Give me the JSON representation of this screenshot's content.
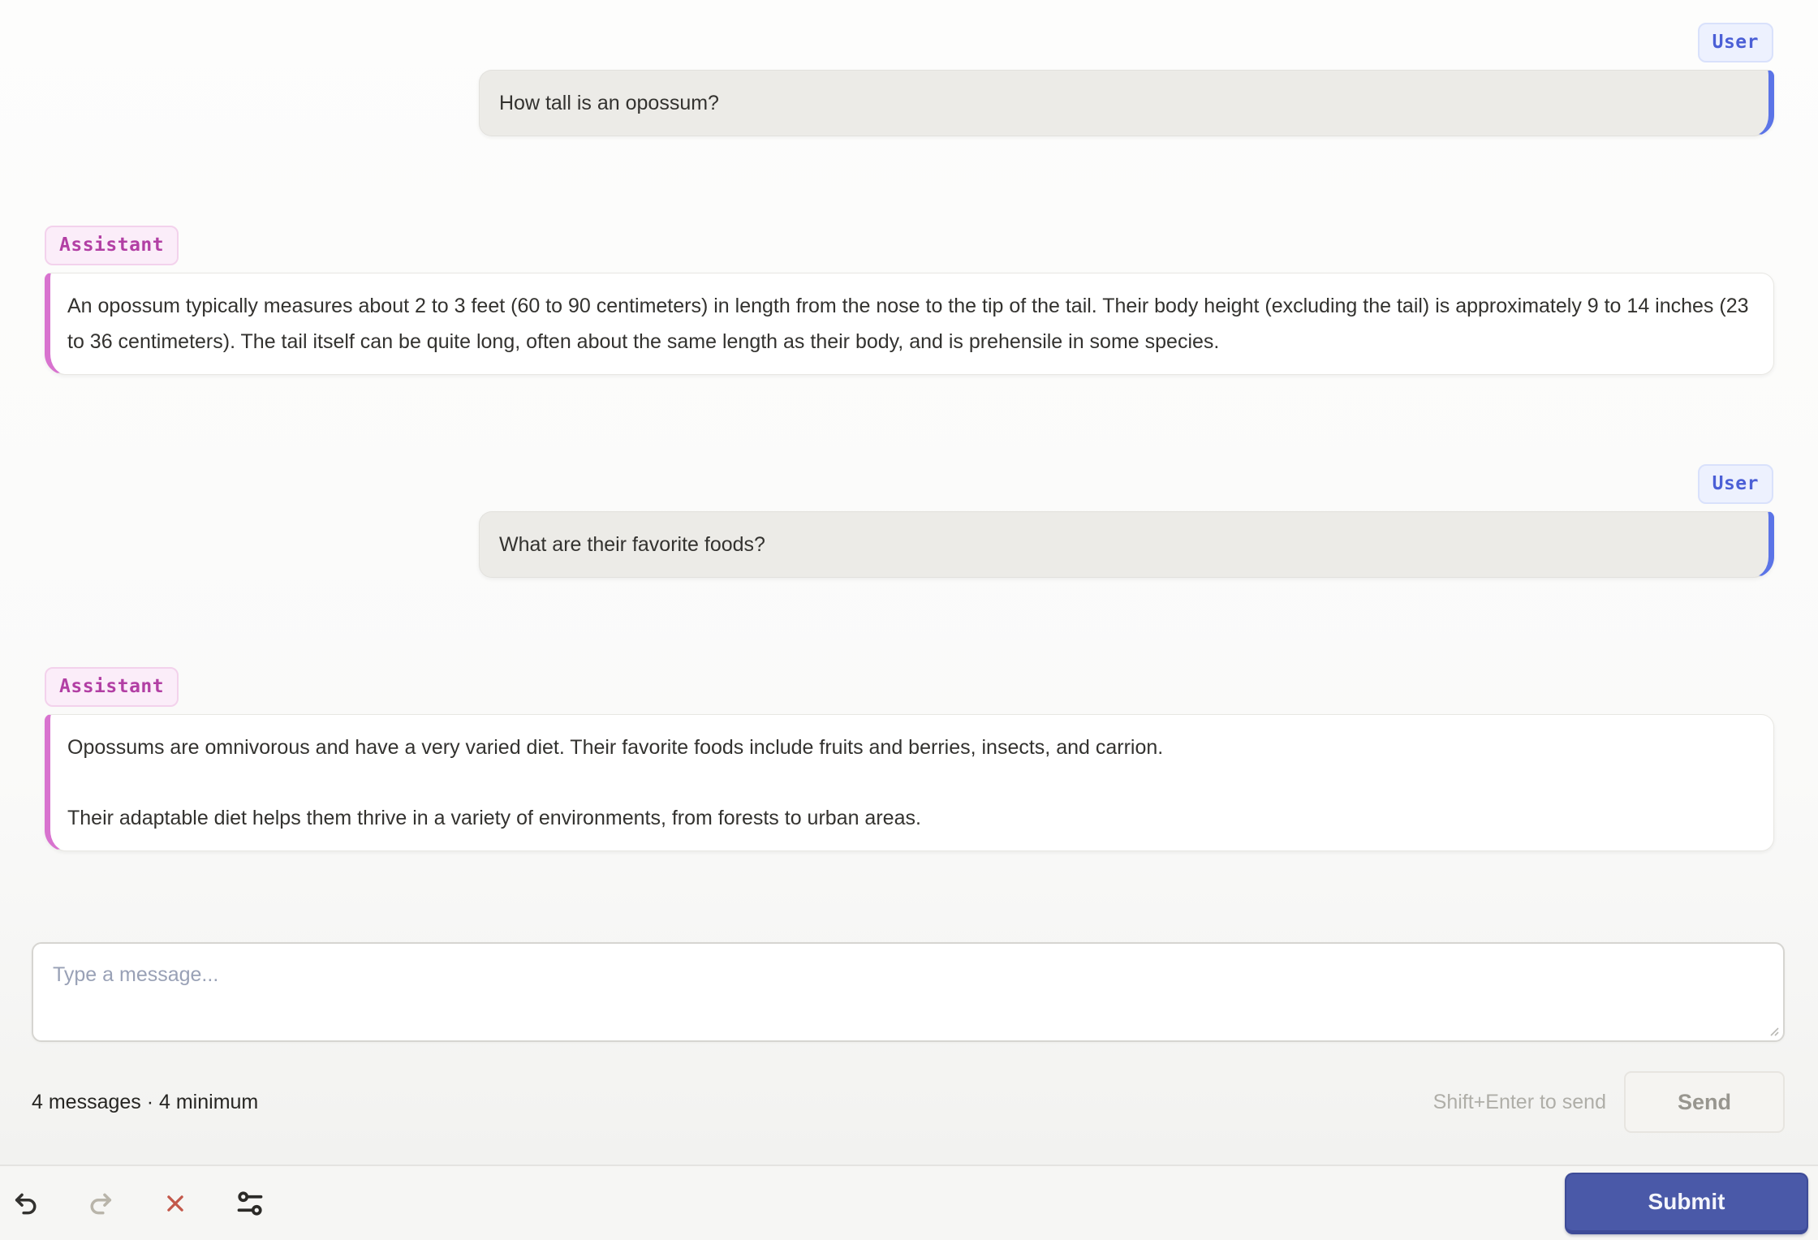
{
  "conversation": {
    "messages": [
      {
        "role": "User",
        "text": "How tall is an opossum?"
      },
      {
        "role": "Assistant",
        "paragraphs": [
          "An opossum typically measures about 2 to 3 feet (60 to 90 centimeters) in length from the nose to the tip of the tail. Their body height (excluding the tail) is approximately 9 to 14 inches (23 to 36 centimeters). The tail itself can be quite long, often about the same length as their body, and is prehensile in some species."
        ]
      },
      {
        "role": "User",
        "text": "What are their favorite foods?"
      },
      {
        "role": "Assistant",
        "paragraphs": [
          "Opossums are omnivorous and have a very varied diet. Their favorite foods include fruits and berries, insects, and carrion.",
          "Their adaptable diet helps them thrive in a variety of environments, from forests to urban areas."
        ]
      }
    ]
  },
  "composer": {
    "placeholder": "Type a message...",
    "status": "4 messages · 4 minimum",
    "hint": "Shift+Enter to send",
    "send_label": "Send"
  },
  "footer": {
    "submit_label": "Submit",
    "icons": [
      "undo-icon",
      "redo-icon",
      "close-icon",
      "sliders-icon"
    ]
  },
  "colors": {
    "user_accent": "#5B74E7",
    "assistant_accent": "#D873CF",
    "user_badge_text": "#4B5FD6",
    "assistant_badge_text": "#B23FA4",
    "submit_bg": "#4A59A8",
    "close_icon": "#C3584A",
    "undo_icon": "#33322F",
    "redo_icon_disabled": "#B9B5AA"
  }
}
